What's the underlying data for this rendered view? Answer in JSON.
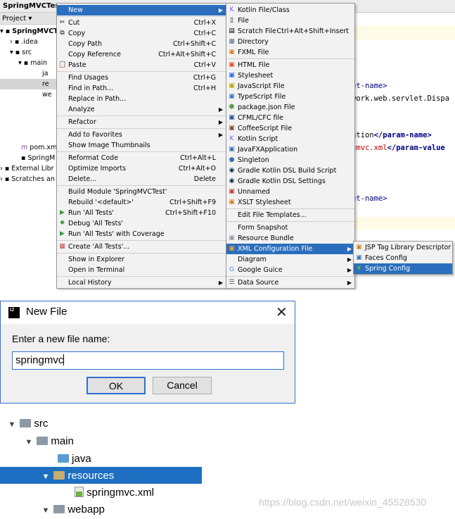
{
  "ide": {
    "title": "SpringMVCTest",
    "project_tab": "Project",
    "tree": [
      "SpringMVCT",
      ".idea",
      "src",
      "main",
      "ja",
      "re",
      "we",
      "pom.xml",
      "SpringM",
      "External Libr",
      "Scratches an"
    ],
    "editor": {
      "line1": "et-name>",
      "line2": "work.web.servlet.Dispa",
      "line3_a": "ation",
      "line3_b": "</param-name>",
      "line4_a": "gmvc.xml",
      "line4_b": "</param-value",
      "line5": "et-name>"
    }
  },
  "menu_main": {
    "new": "New",
    "cut": "Cut",
    "cut_sc": "Ctrl+X",
    "copy": "Copy",
    "copy_sc": "Ctrl+C",
    "copy_path": "Copy Path",
    "copy_path_sc": "Ctrl+Shift+C",
    "copy_ref": "Copy Reference",
    "copy_ref_sc": "Ctrl+Alt+Shift+C",
    "paste": "Paste",
    "paste_sc": "Ctrl+V",
    "find_usages": "Find Usages",
    "find_usages_sc": "Ctrl+G",
    "find_path": "Find in Path...",
    "find_path_sc": "Ctrl+H",
    "replace_path": "Replace in Path...",
    "analyze": "Analyze",
    "refactor": "Refactor",
    "favorites": "Add to Favorites",
    "thumbnails": "Show Image Thumbnails",
    "reformat": "Reformat Code",
    "reformat_sc": "Ctrl+Alt+L",
    "optimize": "Optimize Imports",
    "optimize_sc": "Ctrl+Alt+O",
    "delete": "Delete...",
    "delete_sc": "Delete",
    "build_module": "Build Module 'SpringMVCTest'",
    "rebuild": "Rebuild '<default>'",
    "rebuild_sc": "Ctrl+Shift+F9",
    "run_tests": "Run 'All Tests'",
    "run_tests_sc": "Ctrl+Shift+F10",
    "debug_tests": "Debug 'All Tests'",
    "coverage": "Run 'All Tests' with Coverage",
    "create_tests": "Create 'All Tests'...",
    "explorer": "Show in Explorer",
    "terminal": "Open in Terminal",
    "history": "Local History"
  },
  "menu_new": {
    "kotlin": "Kotlin File/Class",
    "file": "File",
    "scratch": "Scratch File",
    "scratch_sc": "Ctrl+Alt+Shift+Insert",
    "directory": "Directory",
    "fxml": "FXML File",
    "html": "HTML File",
    "stylesheet": "Stylesheet",
    "js": "JavaScript File",
    "ts": "TypeScript File",
    "packagejson": "package.json File",
    "cfml": "CFML/CFC file",
    "coffee": "CoffeeScript File",
    "kscript": "Kotlin Script",
    "javafx": "JavaFXApplication",
    "singleton": "Singleton",
    "gradle_build": "Gradle Kotlin DSL Build Script",
    "gradle_settings": "Gradle Kotlin DSL Settings",
    "unnamed": "Unnamed",
    "xslt": "XSLT Stylesheet",
    "edit_templates": "Edit File Templates...",
    "form_snapshot": "Form Snapshot",
    "resource_bundle": "Resource Bundle",
    "xml_config": "XML Configuration File",
    "diagram": "Diagram",
    "google_guice": "Google Guice",
    "data_source": "Data Source"
  },
  "menu_xml": {
    "jsp_tld": "JSP Tag Library Descriptor",
    "faces": "Faces Config",
    "spring": "Spring Config"
  },
  "dialog": {
    "title": "New File",
    "prompt": "Enter a new file name:",
    "value": "springmvc",
    "ok": "OK",
    "cancel": "Cancel"
  },
  "tree2": {
    "src": "src",
    "main": "main",
    "java": "java",
    "resources": "resources",
    "file": "springmvc.xml",
    "webapp": "webapp"
  },
  "watermark": "https://blog.csdn.net/weixin_45528530",
  "colors": {
    "highlight": "#2a6ebd",
    "selection_tree": "#1e6fc2",
    "editor_tag": "#000080",
    "editor_value": "#c00000"
  }
}
